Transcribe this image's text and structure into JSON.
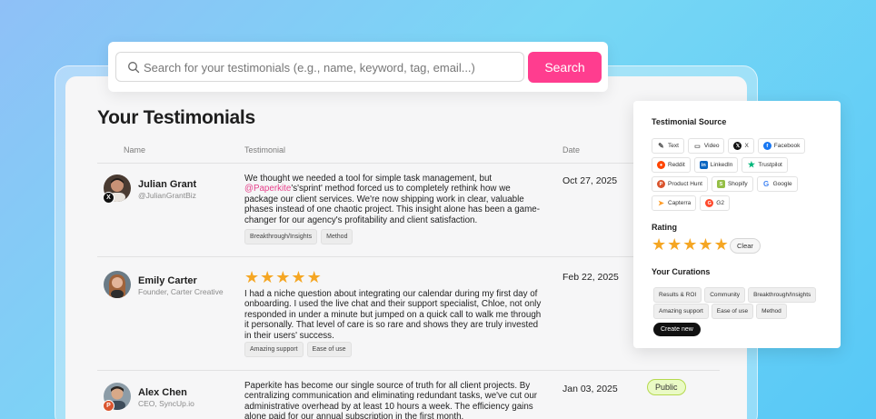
{
  "search": {
    "placeholder": "Search for your testimonials (e.g., name, keyword, tag, email...)",
    "button_label": "Search"
  },
  "page": {
    "title": "Your Testimonials"
  },
  "columns": {
    "name": "Name",
    "testimonial": "Testimonial",
    "date": "Date"
  },
  "rows": [
    {
      "name": "Julian Grant",
      "subtitle": "@JulianGrantBiz",
      "text_before": "We thought we needed a tool for simple task management, but ",
      "mention": "@Paperkite",
      "text_after": "'s'sprint' method forced us to completely rethink how we package our client services. We're now shipping work in clear, valuable phases instead of one chaotic project. This insight alone has been a game-changer for our agency's profitability and client satisfaction.",
      "date": "Oct 27, 2025",
      "tags": [
        "Breakthrough/Insights",
        "Method"
      ],
      "source_badge": "X"
    },
    {
      "name": "Emily Carter",
      "subtitle": "Founder, Carter Creative",
      "rating": 5,
      "text": "I had a niche question about integrating our calendar during my first day of onboarding. I used the live chat and their support specialist, Chloe, not only responded in under a minute but jumped on a quick call to walk me through it personally. That level of care is so rare and shows they are truly invested in their users' success.",
      "date": "Feb 22, 2025",
      "tags": [
        "Amazing support",
        "Ease of use"
      ]
    },
    {
      "name": "Alex Chen",
      "subtitle": "CEO, SyncUp.io",
      "text": "Paperkite has become our single source of truth for all client projects. By centralizing communication and eliminating redundant tasks, we've cut our administrative overhead by at least 10 hours a week. The efficiency gains alone paid for our annual subscription in the first month.",
      "date": "Jan 03, 2025",
      "status": "Public",
      "source_badge": "P"
    }
  ],
  "filters": {
    "source_heading": "Testimonial Source",
    "sources": [
      {
        "label": "Text",
        "icon": "pencil-icon"
      },
      {
        "label": "Video",
        "icon": "video-icon"
      },
      {
        "label": "X",
        "icon": "x-icon"
      },
      {
        "label": "Facebook",
        "icon": "facebook-icon"
      },
      {
        "label": "Reddit",
        "icon": "reddit-icon"
      },
      {
        "label": "LinkedIn",
        "icon": "linkedin-icon"
      },
      {
        "label": "Trustpilot",
        "icon": "trustpilot-icon"
      },
      {
        "label": "Product Hunt",
        "icon": "producthunt-icon"
      },
      {
        "label": "Shopify",
        "icon": "shopify-icon"
      },
      {
        "label": "Google",
        "icon": "google-icon"
      },
      {
        "label": "Capterra",
        "icon": "capterra-icon"
      },
      {
        "label": "G2",
        "icon": "g2-icon"
      }
    ],
    "rating_heading": "Rating",
    "rating_value": 5,
    "clear_label": "Clear",
    "curations_heading": "Your Curations",
    "curations": [
      "Results & ROI",
      "Community",
      "Breakthrough/Insights",
      "Amazing support",
      "Ease of use",
      "Method"
    ],
    "create_label": "Create new"
  },
  "colors": {
    "accent": "#ff3d8f",
    "star": "#f5a623",
    "public_bg": "#eafac5",
    "public_border": "#b5d94f"
  }
}
